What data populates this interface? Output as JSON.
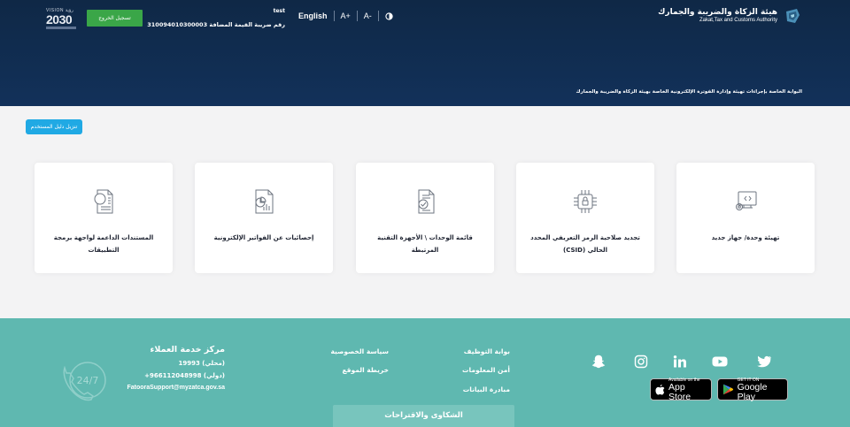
{
  "header": {
    "org_name_ar": "هيئة الزكاة والضريبة والجمارك",
    "org_name_en": "Zakat,Tax and Customs Authority",
    "language_toggle": "English",
    "font_increase": "A+",
    "font_decrease": "A-",
    "user_name": "test",
    "vat_number_line": "رقم ضريبة القيمة المضافة 310094010300003",
    "logout_label": "تسجيل الخروج",
    "vision_top": "VISION رؤية",
    "vision_year": "2030",
    "tagline": "البوابة الخاصة بإجراءات تهيئة وإدارة الفوترة الإلكترونية الخاصة بهيئة الزكاة والضريبة والجمارك"
  },
  "main": {
    "user_guide_button": "تنزيل دليل المستخدم",
    "cards": [
      {
        "label": "تهيئة وحدة/ جهاز جديد",
        "icon": "device-setup-icon"
      },
      {
        "label": "تجديد صلاحية الرمز التعريفي المحدد الحالي (CSID)",
        "icon": "chip-lock-icon"
      },
      {
        "label": "قائمة الوحدات \\ الأجهزة التقنية المرتبطة",
        "icon": "document-check-icon"
      },
      {
        "label": "إحصائيات عن الفواتير الإلكترونية",
        "icon": "statistics-report-icon"
      },
      {
        "label": "المستندات الداعمة لواجهة برمجة التطبيقات",
        "icon": "api-document-icon"
      }
    ]
  },
  "footer": {
    "social_icons": [
      "twitter-icon",
      "youtube-icon",
      "linkedin-icon",
      "instagram-icon",
      "snapchat-icon"
    ],
    "google_play_small": "GET IT ON",
    "google_play_big": "Google Play",
    "app_store_small": "Available on the",
    "app_store_big": "App Store",
    "links_col1": [
      "بوابة التوظيف",
      "أمن المعلومات",
      "مبادرة البيانات"
    ],
    "links_col2": [
      "سياسة الخصوصية",
      "خريطة الموقع"
    ],
    "complaints_label": "الشكاوى والاقتراحات",
    "customer_service": {
      "title": "مركز خدمة العملاء",
      "local": "(محلي) 19993",
      "international": "(دولي) 966112048998+",
      "email": "FatooraSupport@myzatca.gov.sa",
      "badge": "24/7"
    }
  },
  "colors": {
    "header_bg": "#12315a",
    "logout_green": "#3aa648",
    "guide_blue": "#20a9e4",
    "footer_teal": "#5fb8b0",
    "icon_gray": "#6e7580"
  }
}
